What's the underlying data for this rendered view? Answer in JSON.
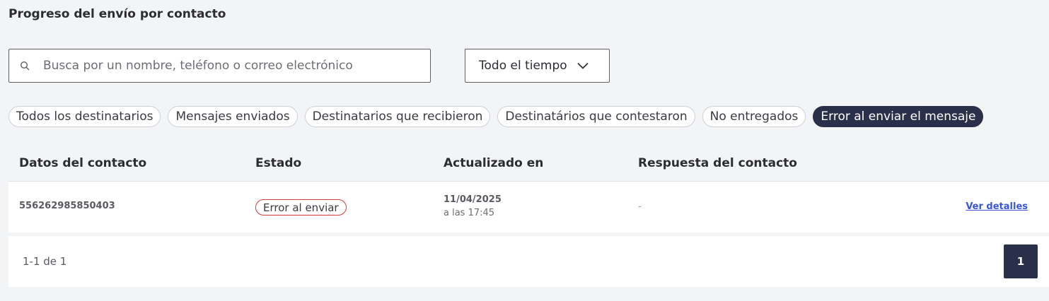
{
  "header": {
    "title": "Progreso del envío por contacto"
  },
  "search": {
    "placeholder": "Busca por un nombre, teléfono o correo electrónico",
    "value": ""
  },
  "time_filter": {
    "selected": "Todo el tiempo"
  },
  "chips": [
    {
      "label": "Todos los destinatarios",
      "active": false
    },
    {
      "label": "Mensajes enviados",
      "active": false
    },
    {
      "label": "Destinatarios que recibieron",
      "active": false
    },
    {
      "label": "Destinatários que contestaron",
      "active": false
    },
    {
      "label": "No entregados",
      "active": false
    },
    {
      "label": "Error al enviar el mensaje",
      "active": true
    }
  ],
  "table": {
    "columns": [
      "Datos del contacto",
      "Estado",
      "Actualizado en",
      "Respuesta del contacto"
    ],
    "rows": [
      {
        "contact": "556262985850403",
        "status": "Error al enviar",
        "date": "11/04/2025",
        "time": "a las 17:45",
        "reply": "-",
        "action": "Ver detalles"
      }
    ]
  },
  "pagination": {
    "range": "1-1 de 1",
    "current_page": "1"
  },
  "colors": {
    "accent": "#2a2f4a",
    "error": "#d23c3c",
    "link": "#3a55d6",
    "background": "#f3f4f5"
  },
  "icons": {
    "search": "search-icon",
    "dropdown": "chevron-down-icon"
  }
}
